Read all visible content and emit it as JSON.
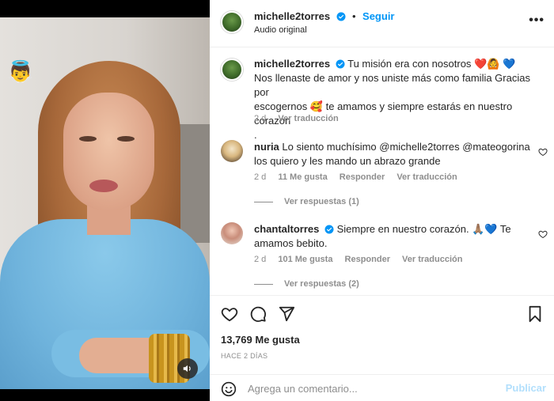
{
  "post": {
    "username": "michelle2torres",
    "follow_label": "Seguir",
    "audio_label": "Audio original",
    "caption_line1": "Tu misión era con nosotros ❤️🙆 💙",
    "caption_line2": "Nos llenaste de amor y nos uniste más como familia Gracias por",
    "caption_line3": "escogernos 🥰 te amamos y siempre estarás en nuestro corazón",
    "caption_line4": ".",
    "caption_age": "2 d",
    "see_translation": "Ver traducción"
  },
  "comments": [
    {
      "username": "nuria",
      "text_line1": "Lo siento muchísimo @michelle2torres @mateogorina",
      "text_line2": "los quiero y les mando un abrazo grande",
      "age": "2 d",
      "likes": "11 Me gusta",
      "reply_label": "Responder",
      "translate_label": "Ver traducción",
      "view_replies": "Ver respuestas (1)"
    },
    {
      "username": "chantaltorres",
      "text_line1": "Siempre en nuestro corazón. 🙏🏽💙 Te",
      "text_line2": "amamos bebito.",
      "age": "2 d",
      "likes": "101 Me gusta",
      "reply_label": "Responder",
      "translate_label": "Ver traducción",
      "view_replies": "Ver respuestas (2)"
    }
  ],
  "stats": {
    "likes": "13,769 Me gusta",
    "posted": "HACE 2 DÍAS"
  },
  "composer": {
    "placeholder": "Agrega un comentario...",
    "post_label": "Publicar"
  },
  "overlay": {
    "sticker": "👼"
  },
  "colors": {
    "accent": "#0095f6",
    "verified": "#0095f6",
    "muted_text": "#8e8e8e",
    "post_disabled": "#b2dffc"
  }
}
